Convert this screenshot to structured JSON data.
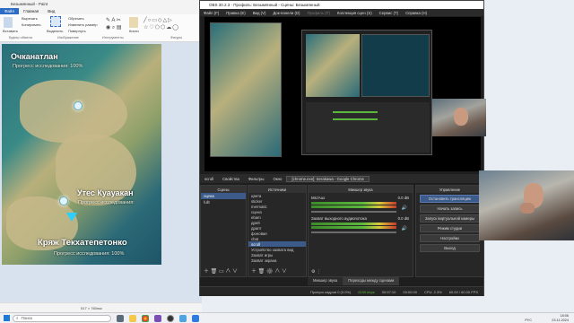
{
  "paint": {
    "title": "Безымянный - Paint",
    "tabs": [
      "Файл",
      "Главная",
      "Вид"
    ],
    "ribbon": {
      "paste": "Вставить",
      "cut": "Вырезать",
      "copy": "Копировать",
      "select": "Выделить",
      "crop": "Обрезать",
      "resize": "Изменить размер",
      "rotate": "Повернуть",
      "brushes": "Кисти",
      "shapes": "Фигуры",
      "groups": [
        "Буфер обмена",
        "Изображение",
        "Инструменты",
        "Фигуры"
      ]
    },
    "map": {
      "region1": "Очканатлан",
      "progress1": "Прогресс исследования: 100%",
      "cliff": "Утес Куауакан",
      "cliff_progress": "Прогресс исследования:",
      "ridge": "Кряж Текхатепетонко",
      "ridge_progress": "Прогресс исследования: 100%"
    },
    "status": "517 × 760пкс"
  },
  "obs": {
    "title": "OBS 30.2.3 - Профиль: Безымянный - Сцены: Безымянный",
    "menu": [
      "Файл (F)",
      "Правка (E)",
      "Вид (V)",
      "Док-панели (D)",
      "Профиль (P)",
      "Коллекция сцен (S)",
      "Сервис (T)",
      "Справка (H)"
    ],
    "source_bar": [
      "scroll",
      "Свойства",
      "Фильтры",
      "Окно",
      "[chrome.exe]: Serakawa - Google Chrome"
    ],
    "scenes_title": "Сцены",
    "scenes": [
      "сцена",
      "fullt"
    ],
    "sources_title": "Источники",
    "sources": [
      "цвета",
      "sticker",
      "merrsatic",
      "сцена",
      "ebam",
      "дрей",
      "драпт",
      "фоновая",
      "chat",
      "scroll",
      "Устройство захвата вид",
      "Захват игры",
      "Захват экрана"
    ],
    "mixer_title": "Микшер звука",
    "mixer": [
      {
        "name": "Mic/Aux",
        "value": "0.0 dB"
      },
      {
        "name": "Захват выходного аудиопотока",
        "value": "0.0 dB"
      }
    ],
    "transitions_tab": "Переходы между сценами",
    "mixer_tab": "Микшер звука",
    "controls_title": "Управление",
    "controls": [
      "Остановить трансляцию",
      "Начать запись",
      "Запуск виртуальной камеры",
      "Режим студии",
      "Настройки",
      "Выход"
    ],
    "status": {
      "dropped": "Пропуск кадров 0 (0.0%)",
      "bitrate": "6190 kbps",
      "stream_time": "00:57:10",
      "rec_time": "00:00:00",
      "cpu": "CPU: 2.3%",
      "fps": "60.00 / 60.00 FPS"
    }
  },
  "taskbar": {
    "search_placeholder": "Поиск",
    "lang": "РУС",
    "time": "18:06",
    "date": "23.11.2024"
  }
}
